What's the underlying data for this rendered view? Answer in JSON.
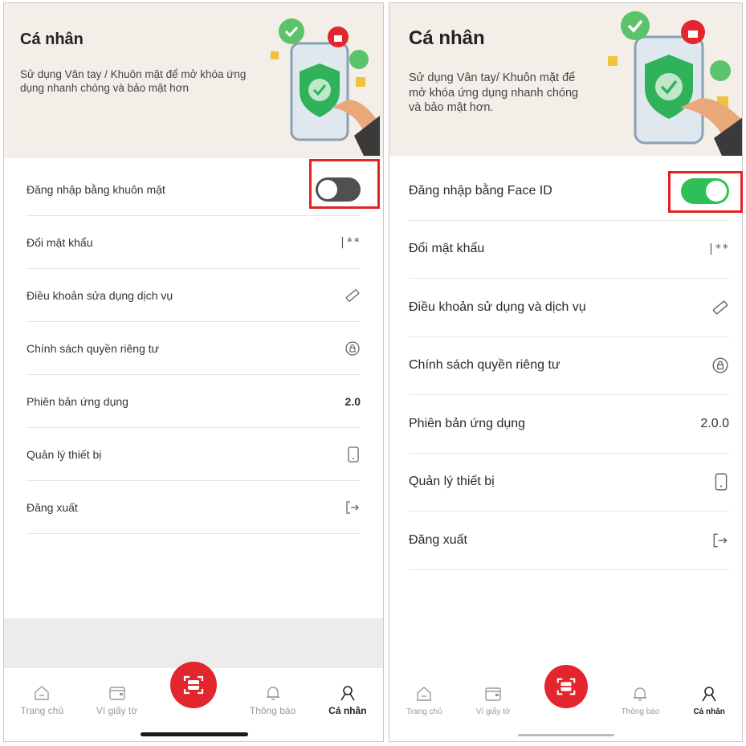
{
  "left": {
    "title": "Cá nhân",
    "description": "Sử dụng Vân tay / Khuôn mặt để mở khóa ứng dụng nhanh chóng và bảo mật hơn",
    "toggle_on": false,
    "rows": [
      {
        "label": "Đăng nhập bằng khuôn mặt",
        "type": "toggle"
      },
      {
        "label": "Đổi mật khẩu",
        "value": "|**",
        "icon": "password-icon"
      },
      {
        "label": "Điều khoản sửa dụng dịch vụ",
        "icon": "ruler-icon"
      },
      {
        "label": "Chính sách quyền riêng tư",
        "icon": "privacy-icon"
      },
      {
        "label": "Phiên bản ứng dụng",
        "value": "2.0"
      },
      {
        "label": "Quản lý thiết bị",
        "icon": "phone-icon"
      },
      {
        "label": "Đăng xuất",
        "icon": "logout-icon"
      }
    ],
    "tabs": [
      {
        "label": "Trang chủ",
        "icon": "home-icon"
      },
      {
        "label": "Ví giấy tờ",
        "icon": "wallet-icon"
      },
      {
        "label": "",
        "icon": "scan-icon"
      },
      {
        "label": "Thông báo",
        "icon": "bell-icon"
      },
      {
        "label": "Cá nhân",
        "icon": "person-icon",
        "active": true
      }
    ]
  },
  "right": {
    "title": "Cá nhân",
    "description": "Sử dụng Vân tay/ Khuôn mặt để mở  khóa ứng dụng nhanh chóng và bảo mật hơn.",
    "toggle_on": true,
    "rows": [
      {
        "label": "Đăng nhập bằng Face ID",
        "type": "toggle"
      },
      {
        "label": "Đổi mật khẩu",
        "value": "|**",
        "icon": "password-icon"
      },
      {
        "label": "Điều khoản sử dụng và dịch vụ",
        "icon": "ruler-icon"
      },
      {
        "label": "Chính sách quyền riêng tư",
        "icon": "privacy-icon"
      },
      {
        "label": "Phiên bản ứng dụng",
        "value": "2.0.0"
      },
      {
        "label": "Quản lý thiết bị",
        "icon": "phone-icon"
      },
      {
        "label": "Đăng xuất",
        "icon": "logout-icon"
      }
    ],
    "tabs": [
      {
        "label": "Trang chủ",
        "icon": "home-icon"
      },
      {
        "label": "Ví giấy tờ",
        "icon": "wallet-icon"
      },
      {
        "label": "",
        "icon": "scan-icon"
      },
      {
        "label": "Thông báo",
        "icon": "bell-icon"
      },
      {
        "label": "Cá nhân",
        "icon": "person-icon",
        "active": true
      }
    ]
  },
  "colors": {
    "accent_red": "#e3262d",
    "toggle_on": "#2fbf57",
    "toggle_off": "#505050",
    "highlight_box": "#e52222",
    "hero_bg": "#f3efe8"
  }
}
